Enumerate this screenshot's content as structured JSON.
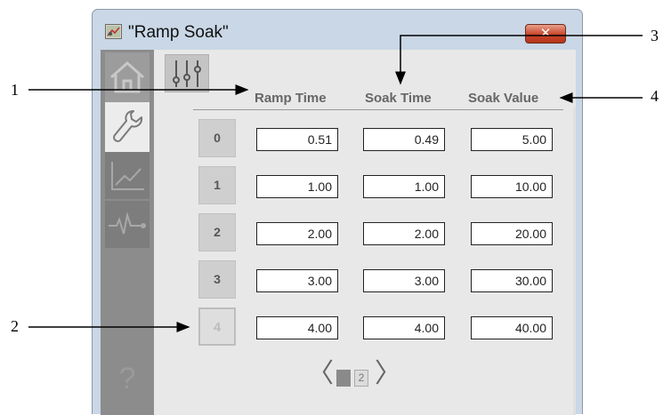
{
  "window": {
    "title": "\"Ramp Soak\"",
    "close_label": "✕"
  },
  "sidebar": {
    "items": [
      {
        "name": "home",
        "icon": "home-icon"
      },
      {
        "name": "maintenance",
        "icon": "wrench-icon"
      },
      {
        "name": "trend",
        "icon": "trend-icon"
      },
      {
        "name": "diagnostics",
        "icon": "pulse-icon"
      }
    ],
    "help_label": "?"
  },
  "table": {
    "headers": [
      "Ramp Time",
      "Soak Time",
      "Soak Value"
    ],
    "rows": [
      {
        "index": "0",
        "ramp": "0.51",
        "soak": "0.49",
        "value": "5.00"
      },
      {
        "index": "1",
        "ramp": "1.00",
        "soak": "1.00",
        "value": "10.00"
      },
      {
        "index": "2",
        "ramp": "2.00",
        "soak": "2.00",
        "value": "20.00"
      },
      {
        "index": "3",
        "ramp": "3.00",
        "soak": "3.00",
        "value": "30.00"
      },
      {
        "index": "4",
        "ramp": "4.00",
        "soak": "4.00",
        "value": "40.00"
      }
    ]
  },
  "pager": {
    "prev": "〈",
    "next": "〉",
    "pages": [
      "1",
      "2"
    ],
    "current_page": "1"
  },
  "callouts": [
    "1",
    "2",
    "3",
    "4"
  ],
  "colors": {
    "window_frame": "#c9d7e6",
    "close_button": "#c8452a",
    "sidebar": "#8c8c8c",
    "panel": "#e8e8e8"
  }
}
